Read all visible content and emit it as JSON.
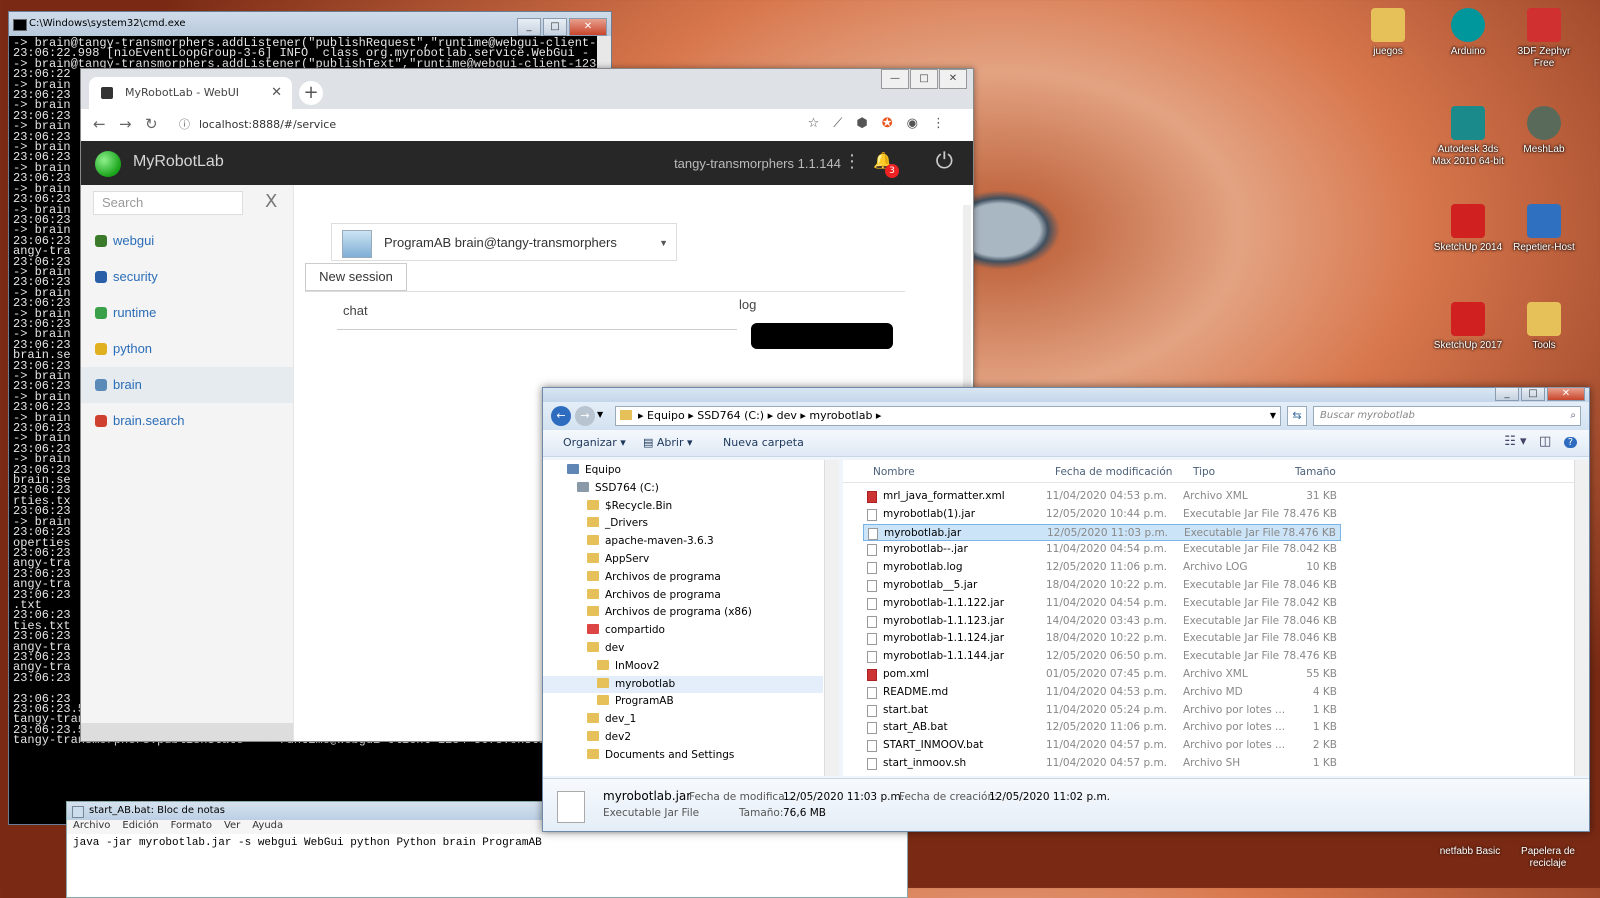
{
  "cmd": {
    "title": "C:\\Windows\\system32\\cmd.exe",
    "lines": [
      "-> brain@tangy-transmorphers.addListener(\"publishRequest\",\"runtime@webgui-client-12",
      "23:06:22.998 [nioEventLoopGroup-3-6] INFO  class org.myrobotlab.service.WebGui - in",
      "-> brain@tangy-transmorphers.addListener(\"publishText\",\"runtime@webgui-client-1234-",
      "23:06:22",
      "-> brain",
      "23:06:23",
      "-> brain",
      "23:06:23",
      "-> brain",
      "23:06:23",
      "-> brain",
      "23:06:23",
      "-> brain",
      "23:06:23",
      "-> brain",
      "23:06:23",
      "-> brain",
      "23:06:23",
      "-> brain",
      "23:06:23",
      "angy-tra",
      "23:06:23",
      "-> brain",
      "23:06:23",
      "-> brain",
      "23:06:23",
      "-> brain",
      "23:06:23",
      "-> brain",
      "23:06:23",
      "brain.se",
      "23:06:23",
      "-> brain",
      "23:06:23",
      "-> brain",
      "23:06:23",
      "-> brain",
      "23:06:23",
      "-> brain",
      "23:06:23",
      "-> brain",
      "23:06:23",
      "brain.se",
      "23:06:23",
      "rties.tx",
      "23:06:23",
      "-> brain",
      "23:06:23",
      "operties",
      "23:06:23",
      "angy-tra",
      "23:06:23",
      "angy-tra",
      "23:06:23",
      ".txt",
      "23:06:23",
      "ties.txt",
      "23:06:23",
      "angy-tra",
      "23:06:23",
      "angy-tra",
      "23:06:23",
      "",
      "23:06:23",
      "23:06:23.517 [brain_outbox_0] WARN  class org.myrobotlab.service.WebGui - se",
      "tangy-transmorphers.publishState --> runtime@webgui-client-1234-5678.onState",
      "23:06:23.518 [brain_outbox_0] WARN  class org.myrobotlab.service.WebGui - se",
      "tangy-transmorphers.publishState --> runtime@webgui-client-1234-5678.onState"
    ]
  },
  "chrome": {
    "tab_title": "MyRobotLab - WebUI",
    "url": "localhost:8888/#/service"
  },
  "mrl": {
    "brand": "MyRobotLab",
    "instance": "tangy-transmorphers 1.1.144",
    "notifications": "3",
    "search_placeholder": "Search",
    "search_clear": "X",
    "services": [
      {
        "label": "webgui",
        "color": "#3a7a2a"
      },
      {
        "label": "security",
        "color": "#2a5fa8"
      },
      {
        "label": "runtime",
        "color": "#3aa04a"
      },
      {
        "label": "python",
        "color": "#e0b020"
      },
      {
        "label": "brain",
        "color": "#5a8ab8"
      },
      {
        "label": "brain.search",
        "color": "#d04030"
      }
    ],
    "selected_service": "ProgramAB  brain@tangy-transmorphers",
    "new_session": "New session",
    "chat_label": "chat",
    "log_label": "log"
  },
  "explorer": {
    "path": [
      "Equipo",
      "SSD764 (C:)",
      "dev",
      "myrobotlab"
    ],
    "search_placeholder": "Buscar myrobotlab",
    "commands": {
      "organize": "Organizar",
      "open": "Abrir",
      "new_folder": "Nueva carpeta"
    },
    "tree": [
      {
        "label": "Equipo",
        "indent": 0
      },
      {
        "label": "SSD764 (C:)",
        "indent": 1
      },
      {
        "label": "$Recycle.Bin",
        "indent": 2
      },
      {
        "label": "_Drivers",
        "indent": 2
      },
      {
        "label": "apache-maven-3.6.3",
        "indent": 2
      },
      {
        "label": "AppServ",
        "indent": 2
      },
      {
        "label": "Archivos de programa",
        "indent": 2
      },
      {
        "label": "Archivos de programa",
        "indent": 2
      },
      {
        "label": "Archivos de programa (x86)",
        "indent": 2
      },
      {
        "label": "compartido",
        "indent": 2
      },
      {
        "label": "dev",
        "indent": 2
      },
      {
        "label": "InMoov2",
        "indent": 3
      },
      {
        "label": "myrobotlab",
        "indent": 3
      },
      {
        "label": "ProgramAB",
        "indent": 3
      },
      {
        "label": "dev_1",
        "indent": 2
      },
      {
        "label": "dev2",
        "indent": 2
      },
      {
        "label": "Documents and Settings",
        "indent": 2
      }
    ],
    "selected_tree": 12,
    "columns": {
      "name": "Nombre",
      "modified": "Fecha de modificación",
      "type": "Tipo",
      "size": "Tamaño"
    },
    "files": [
      {
        "name": "mrl_java_formatter.xml",
        "modified": "11/04/2020 04:53 p.m.",
        "type": "Archivo XML",
        "size": "31 KB",
        "kind": "xml"
      },
      {
        "name": "myrobotlab(1).jar",
        "modified": "12/05/2020 10:44 p.m.",
        "type": "Executable Jar File",
        "size": "78.476 KB",
        "kind": "jar"
      },
      {
        "name": "myrobotlab.jar",
        "modified": "12/05/2020 11:03 p.m.",
        "type": "Executable Jar File",
        "size": "78.476 KB",
        "kind": "jar"
      },
      {
        "name": "myrobotlab--.jar",
        "modified": "11/04/2020 04:54 p.m.",
        "type": "Executable Jar File",
        "size": "78.042 KB",
        "kind": "jar"
      },
      {
        "name": "myrobotlab.log",
        "modified": "12/05/2020 11:06 p.m.",
        "type": "Archivo LOG",
        "size": "10 KB",
        "kind": "log"
      },
      {
        "name": "myrobotlab__5.jar",
        "modified": "18/04/2020 10:22 p.m.",
        "type": "Executable Jar File",
        "size": "78.046 KB",
        "kind": "jar"
      },
      {
        "name": "myrobotlab-1.1.122.jar",
        "modified": "11/04/2020 04:54 p.m.",
        "type": "Executable Jar File",
        "size": "78.042 KB",
        "kind": "jar"
      },
      {
        "name": "myrobotlab-1.1.123.jar",
        "modified": "14/04/2020 03:43 p.m.",
        "type": "Executable Jar File",
        "size": "78.046 KB",
        "kind": "jar"
      },
      {
        "name": "myrobotlab-1.1.124.jar",
        "modified": "18/04/2020 10:22 p.m.",
        "type": "Executable Jar File",
        "size": "78.046 KB",
        "kind": "jar"
      },
      {
        "name": "myrobotlab-1.1.144.jar",
        "modified": "12/05/2020 06:50 p.m.",
        "type": "Executable Jar File",
        "size": "78.476 KB",
        "kind": "jar"
      },
      {
        "name": "pom.xml",
        "modified": "01/05/2020 07:45 p.m.",
        "type": "Archivo XML",
        "size": "55 KB",
        "kind": "xml"
      },
      {
        "name": "README.md",
        "modified": "11/04/2020 04:53 p.m.",
        "type": "Archivo MD",
        "size": "4 KB",
        "kind": "md"
      },
      {
        "name": "start.bat",
        "modified": "11/04/2020 05:24 p.m.",
        "type": "Archivo por lotes ...",
        "size": "1 KB",
        "kind": "bat"
      },
      {
        "name": "start_AB.bat",
        "modified": "12/05/2020 11:06 p.m.",
        "type": "Archivo por lotes ...",
        "size": "1 KB",
        "kind": "bat"
      },
      {
        "name": "START_INMOOV.bat",
        "modified": "11/04/2020 04:57 p.m.",
        "type": "Archivo por lotes ...",
        "size": "2 KB",
        "kind": "bat"
      },
      {
        "name": "start_inmoov.sh",
        "modified": "11/04/2020 04:57 p.m.",
        "type": "Archivo SH",
        "size": "1 KB",
        "kind": "sh"
      }
    ],
    "selected_file": 2,
    "details": {
      "name": "myrobotlab.jar",
      "type": "Executable Jar File",
      "modified_label": "Fecha de modifica...",
      "modified": "12/05/2020 11:03 p.m.",
      "size_label": "Tamaño:",
      "size": "76,6 MB",
      "created_label": "Fecha de creación:",
      "created": "12/05/2020 11:02 p.m."
    }
  },
  "notepad": {
    "title": "start_AB.bat: Bloc de notas",
    "menu": [
      "Archivo",
      "Edición",
      "Formato",
      "Ver",
      "Ayuda"
    ],
    "content": "java -jar myrobotlab.jar -s webgui WebGui python Python brain ProgramAB"
  },
  "desktop": {
    "icons": [
      {
        "label": "juegos",
        "color": "#e6c15a"
      },
      {
        "label": "Arduino",
        "color": "#00979c"
      },
      {
        "label": "3DF Zephyr Free",
        "color": "#d03030"
      },
      {
        "label": "Autodesk 3ds Max 2010 64-bit",
        "color": "#1b8a8a"
      },
      {
        "label": "MeshLab",
        "color": "#5a6a5a"
      },
      {
        "label": "SketchUp 2014",
        "color": "#d02020"
      },
      {
        "label": "Repetier-Host",
        "color": "#3070c0"
      },
      {
        "label": "SketchUp 2017",
        "color": "#d02020"
      },
      {
        "label": "Tools",
        "color": "#e6c15a"
      }
    ],
    "bottom_labels": [
      "netfabb Basic",
      "Papelera de reciclaje"
    ]
  }
}
